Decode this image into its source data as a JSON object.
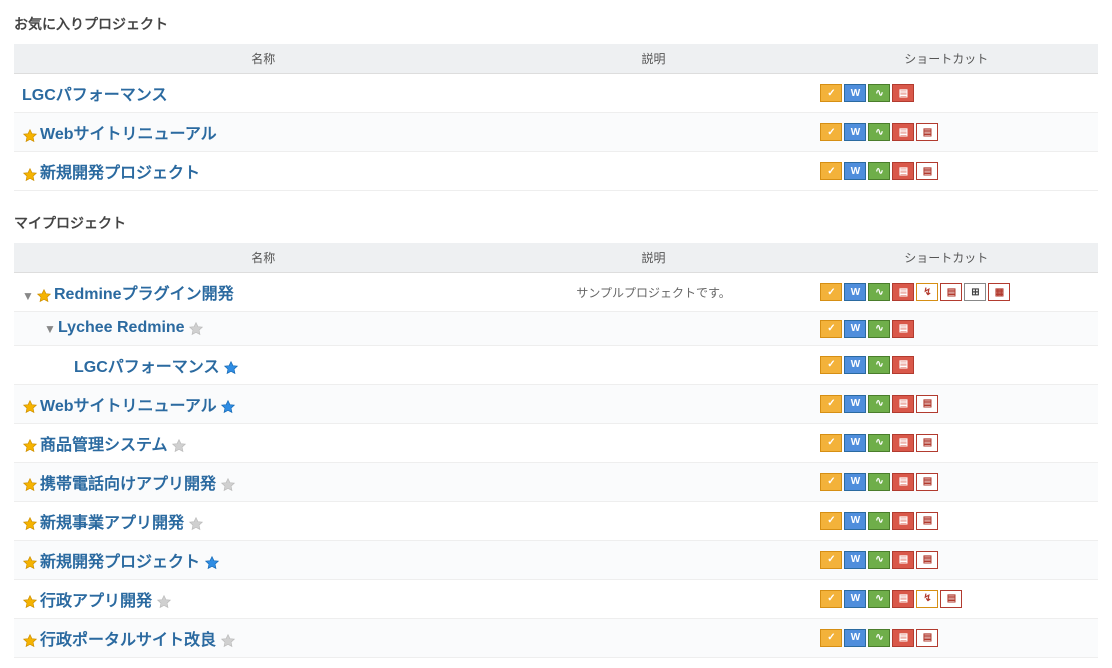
{
  "sections": {
    "favorites": {
      "title": "お気に入りプロジェクト"
    },
    "mine": {
      "title": "マイプロジェクト"
    }
  },
  "headers": {
    "name": "名称",
    "description": "説明",
    "shortcut": "ショートカット"
  },
  "icons": {
    "issues": "✓",
    "wiki": "W",
    "act": "∿",
    "gantt": "▤",
    "chart": "↯",
    "gantt2": "▤",
    "cal": "⊞",
    "kanban": "▦"
  },
  "favorites": [
    {
      "name": "LGCパフォーマンス",
      "star_left": "none",
      "star_right": "none",
      "expander": "",
      "indent": 0,
      "description": "",
      "shortcuts": [
        "issues",
        "wiki",
        "act",
        "gantt"
      ]
    },
    {
      "name": "Webサイトリニューアル",
      "star_left": "gold",
      "star_right": "none",
      "expander": "",
      "indent": 0,
      "description": "",
      "shortcuts": [
        "issues",
        "wiki",
        "act",
        "gantt",
        "gantt2"
      ]
    },
    {
      "name": "新規開発プロジェクト",
      "star_left": "gold",
      "star_right": "none",
      "expander": "",
      "indent": 0,
      "description": "",
      "shortcuts": [
        "issues",
        "wiki",
        "act",
        "gantt",
        "gantt2"
      ]
    }
  ],
  "mine": [
    {
      "name": "Redmineプラグイン開発",
      "star_left": "gold",
      "star_right": "none",
      "expander": "▼",
      "indent": 0,
      "description": "サンプルプロジェクトです。",
      "shortcuts": [
        "issues",
        "wiki",
        "act",
        "gantt",
        "chart",
        "gantt2",
        "cal",
        "kanban"
      ]
    },
    {
      "name": "Lychee Redmine",
      "star_left": "none",
      "star_right": "gray",
      "expander": "▼",
      "indent": 1,
      "description": "",
      "shortcuts": [
        "issues",
        "wiki",
        "act",
        "gantt"
      ]
    },
    {
      "name": "LGCパフォーマンス",
      "star_left": "none",
      "star_right": "blue",
      "expander": "",
      "indent": 2,
      "description": "",
      "shortcuts": [
        "issues",
        "wiki",
        "act",
        "gantt"
      ]
    },
    {
      "name": "Webサイトリニューアル",
      "star_left": "gold",
      "star_right": "blue",
      "expander": "",
      "indent": 0,
      "description": "",
      "shortcuts": [
        "issues",
        "wiki",
        "act",
        "gantt",
        "gantt2"
      ]
    },
    {
      "name": "商品管理システム",
      "star_left": "gold",
      "star_right": "gray",
      "expander": "",
      "indent": 0,
      "description": "",
      "shortcuts": [
        "issues",
        "wiki",
        "act",
        "gantt",
        "gantt2"
      ]
    },
    {
      "name": "携帯電話向けアプリ開発",
      "star_left": "gold",
      "star_right": "gray",
      "expander": "",
      "indent": 0,
      "description": "",
      "shortcuts": [
        "issues",
        "wiki",
        "act",
        "gantt",
        "gantt2"
      ]
    },
    {
      "name": "新規事業アプリ開発",
      "star_left": "gold",
      "star_right": "gray",
      "expander": "",
      "indent": 0,
      "description": "",
      "shortcuts": [
        "issues",
        "wiki",
        "act",
        "gantt",
        "gantt2"
      ]
    },
    {
      "name": "新規開発プロジェクト",
      "star_left": "gold",
      "star_right": "blue",
      "expander": "",
      "indent": 0,
      "description": "",
      "shortcuts": [
        "issues",
        "wiki",
        "act",
        "gantt",
        "gantt2"
      ]
    },
    {
      "name": "行政アプリ開発",
      "star_left": "gold",
      "star_right": "gray",
      "expander": "",
      "indent": 0,
      "description": "",
      "shortcuts": [
        "issues",
        "wiki",
        "act",
        "gantt",
        "chart",
        "gantt2"
      ]
    },
    {
      "name": "行政ポータルサイト改良",
      "star_left": "gold",
      "star_right": "gray",
      "expander": "",
      "indent": 0,
      "description": "",
      "shortcuts": [
        "issues",
        "wiki",
        "act",
        "gantt",
        "gantt2"
      ]
    }
  ]
}
